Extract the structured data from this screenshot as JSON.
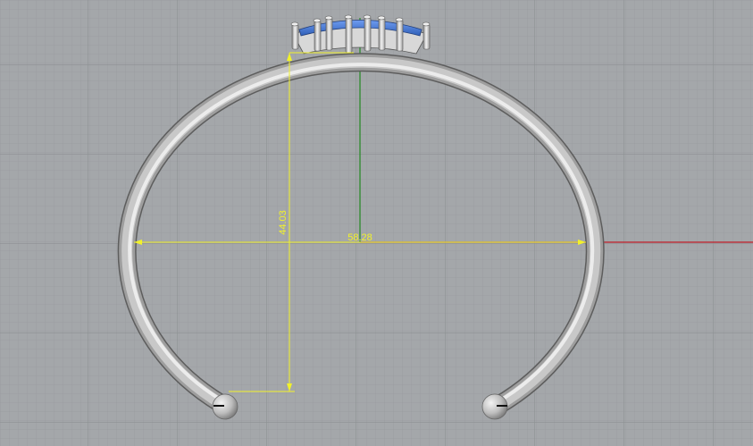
{
  "viewport": {
    "background": "#a4a7aa",
    "grid_minor_color": "#9b9ea1",
    "grid_major_color": "#8d9093",
    "axis_x_color": "#c0202a",
    "axis_y_color": "#2b8a2b"
  },
  "model": {
    "band_color": "#c8c8c8",
    "stone_color": "#4f7fd6",
    "end_ball_color": "#bdbdbd"
  },
  "dimensions": {
    "color": "#f2f22a",
    "width_label": "58.28",
    "height_label": "44.03"
  }
}
